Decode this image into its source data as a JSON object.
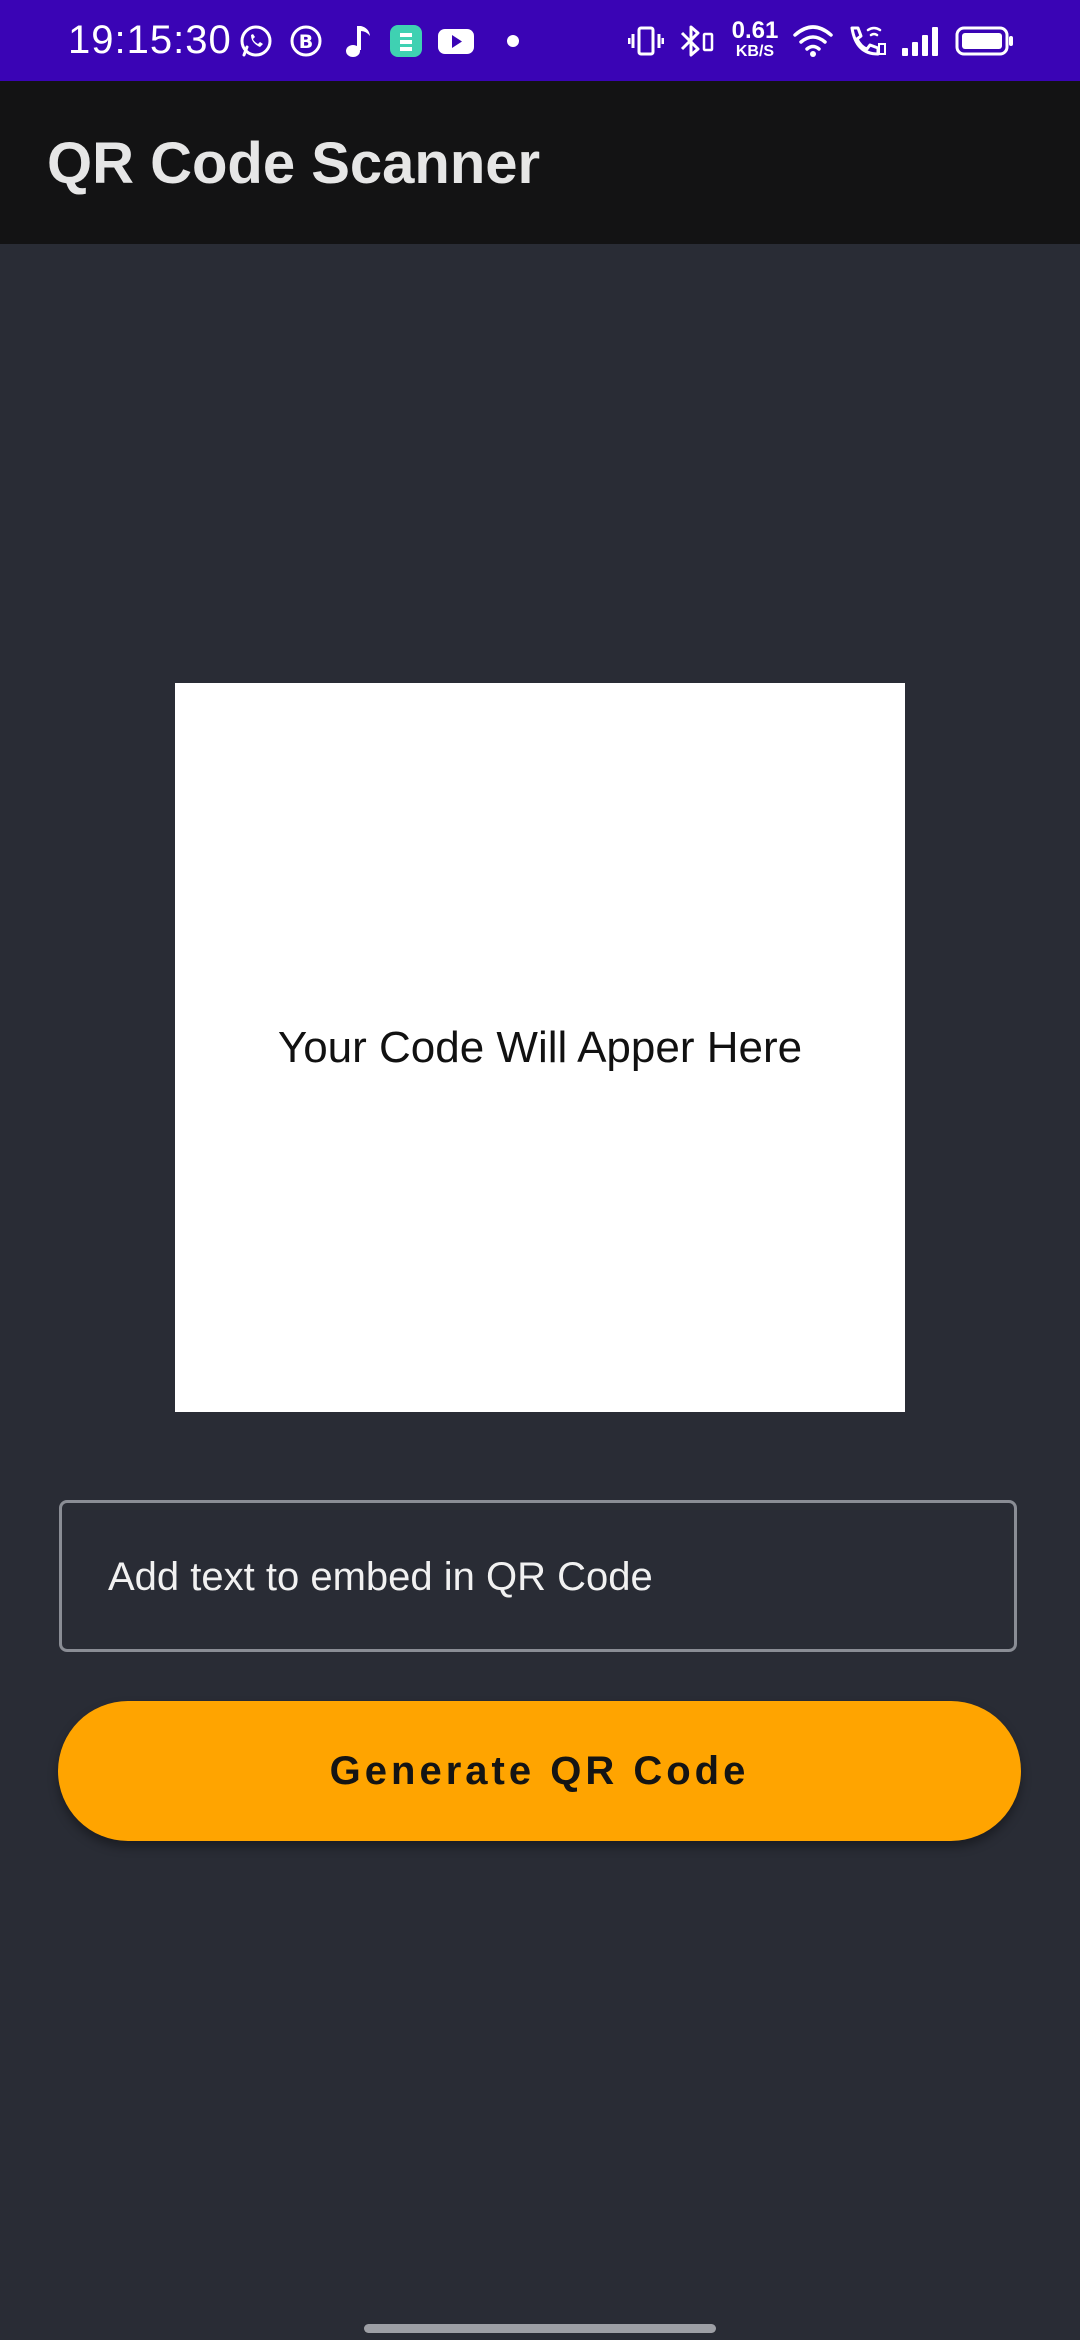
{
  "status_bar": {
    "time": "19:15:30",
    "network_speed_value": "0.61",
    "network_speed_unit": "KB/S",
    "notification_icons": [
      "whatsapp-icon",
      "whatsapp-business-icon",
      "music-note-icon",
      "app-notification-icon",
      "youtube-icon",
      "dot-icon"
    ],
    "system_icons": [
      "vibrate-icon",
      "bluetooth-icon",
      "wifi-icon",
      "wifi-calling-icon",
      "signal-icon",
      "battery-icon"
    ],
    "background_color": "#3a04b5"
  },
  "app_bar": {
    "title": "QR Code Scanner",
    "background_color": "#131314"
  },
  "qr_preview": {
    "placeholder_text": "Your Code Will Apper Here"
  },
  "input": {
    "placeholder": "Add text to embed in QR Code",
    "value": ""
  },
  "generate_button": {
    "label": "Generate QR Code",
    "color": "#ffa400"
  },
  "theme": {
    "background": "#292c35"
  }
}
